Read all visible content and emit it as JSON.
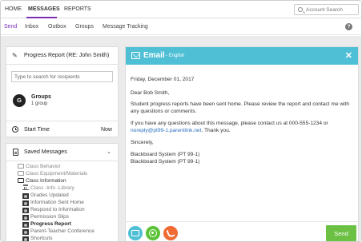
{
  "topnav": {
    "items": [
      "HOME",
      "MESSAGES",
      "REPORTS"
    ],
    "search_placeholder": "Account Search"
  },
  "subnav": {
    "items": [
      "Send",
      "Inbox",
      "Outbox",
      "Groups",
      "Message Tracking"
    ],
    "active": "Send",
    "help": "?"
  },
  "compose": {
    "title": "Progress Report (RE: John Smith)",
    "recipient_placeholder": "Type to search for recipients",
    "group": {
      "avatar_letter": "G",
      "name": "Groups",
      "count": "1 group"
    },
    "start_time": {
      "label": "Start Time",
      "value": "Now"
    }
  },
  "saved_messages": {
    "title": "Saved Messages",
    "items": [
      "Class Behavior",
      "Class Equipment/Materials",
      "Class Information",
      "Class -Info -Library",
      "Grades Updated",
      "Information Sent Home",
      "Respond to Information",
      "Permission Slips",
      "Progress Report",
      "Parent-Teacher Conference",
      "Shortcuts"
    ]
  },
  "email": {
    "header": "Email",
    "language": "- English",
    "date": "Friday, December 01, 2017",
    "greeting": "Dear Bob Smith,",
    "para1": "Student progress reports have been sent home. Please review the report and contact me with any questions or comments.",
    "para2_prefix": "If you have any questions about this message, please contact us at 000-555-1234 or",
    "para2_link": "noreply@pt99-1.parentlink.net",
    "para2_suffix": ". Thank you.",
    "closing": "Sincerely,",
    "signature1": "Blackboard System (PT 99-1)",
    "signature2": "Blackboard System (PT 99-1)",
    "send_label": "Send"
  },
  "colors": {
    "accent_purple": "#7b2fb5",
    "email_teal": "#4fbfd6",
    "chat_green": "#5bc236",
    "phone_orange": "#f06a34",
    "send_green": "#6cc144"
  }
}
